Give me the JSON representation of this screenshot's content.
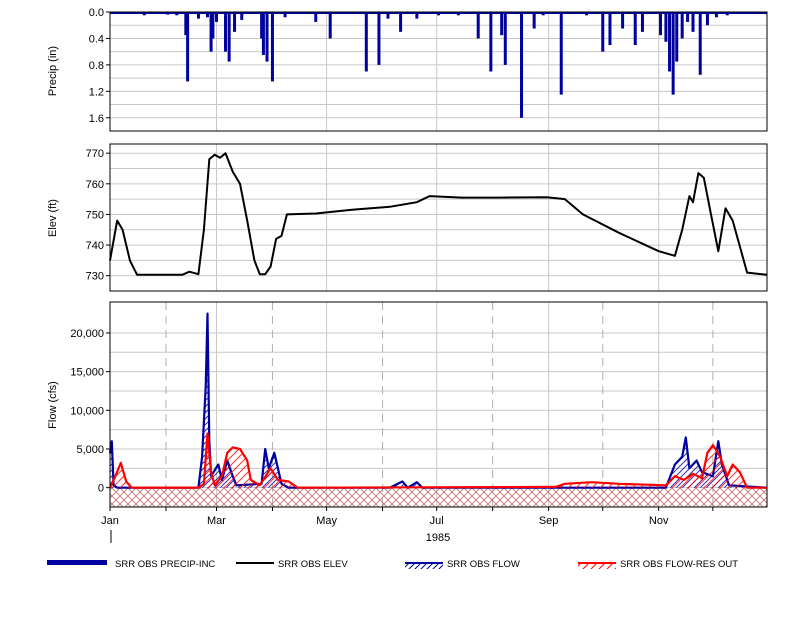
{
  "chart_data": {
    "type": "line",
    "x_axis": {
      "tick_labels": [
        "Jan",
        "Mar",
        "May",
        "Jul",
        "Sep",
        "Nov"
      ],
      "year_label": "1985",
      "range": [
        "1985-01-01",
        "1985-12-31"
      ]
    },
    "panels": {
      "precip": {
        "type": "bar",
        "ylabel": "Precip (in)",
        "ylim": [
          1.8,
          0.0
        ],
        "inverted": true,
        "ticks": [
          "0.0",
          "0.4",
          "0.8",
          "1.2",
          "1.6"
        ],
        "series_name": "SRR OBS PRECIP-INC",
        "color": "#0000a0",
        "events": [
          {
            "date": "1985-01-03",
            "value": 0.02
          },
          {
            "date": "1985-01-09",
            "value": 0.03
          },
          {
            "date": "1985-01-20",
            "value": 0.05
          },
          {
            "date": "1985-01-23",
            "value": 0.03
          },
          {
            "date": "1985-02-02",
            "value": 0.04
          },
          {
            "date": "1985-02-07",
            "value": 0.05
          },
          {
            "date": "1985-02-12",
            "value": 0.35
          },
          {
            "date": "1985-02-13",
            "value": 1.05
          },
          {
            "date": "1985-02-19",
            "value": 0.1
          },
          {
            "date": "1985-02-24",
            "value": 0.08
          },
          {
            "date": "1985-02-26",
            "value": 0.6
          },
          {
            "date": "1985-02-27",
            "value": 0.4
          },
          {
            "date": "1985-03-01",
            "value": 0.15
          },
          {
            "date": "1985-03-06",
            "value": 0.6
          },
          {
            "date": "1985-03-08",
            "value": 0.75
          },
          {
            "date": "1985-03-11",
            "value": 0.3
          },
          {
            "date": "1985-03-15",
            "value": 0.12
          },
          {
            "date": "1985-03-26",
            "value": 0.4
          },
          {
            "date": "1985-03-27",
            "value": 0.65
          },
          {
            "date": "1985-03-29",
            "value": 0.75
          },
          {
            "date": "1985-04-01",
            "value": 1.05
          },
          {
            "date": "1985-04-08",
            "value": 0.08
          },
          {
            "date": "1985-04-25",
            "value": 0.15
          },
          {
            "date": "1985-05-03",
            "value": 0.4
          },
          {
            "date": "1985-05-23",
            "value": 0.9
          },
          {
            "date": "1985-05-30",
            "value": 0.8
          },
          {
            "date": "1985-06-04",
            "value": 0.1
          },
          {
            "date": "1985-06-11",
            "value": 0.3
          },
          {
            "date": "1985-06-20",
            "value": 0.1
          },
          {
            "date": "1985-07-02",
            "value": 0.05
          },
          {
            "date": "1985-07-13",
            "value": 0.05
          },
          {
            "date": "1985-07-24",
            "value": 0.4
          },
          {
            "date": "1985-07-31",
            "value": 0.9
          },
          {
            "date": "1985-08-06",
            "value": 0.35
          },
          {
            "date": "1985-08-08",
            "value": 0.8
          },
          {
            "date": "1985-08-17",
            "value": 1.6
          },
          {
            "date": "1985-08-24",
            "value": 0.25
          },
          {
            "date": "1985-08-29",
            "value": 0.05
          },
          {
            "date": "1985-09-08",
            "value": 1.25
          },
          {
            "date": "1985-09-22",
            "value": 0.05
          },
          {
            "date": "1985-10-01",
            "value": 0.6
          },
          {
            "date": "1985-10-05",
            "value": 0.5
          },
          {
            "date": "1985-10-12",
            "value": 0.25
          },
          {
            "date": "1985-10-19",
            "value": 0.5
          },
          {
            "date": "1985-10-23",
            "value": 0.3
          },
          {
            "date": "1985-11-02",
            "value": 0.35
          },
          {
            "date": "1985-11-05",
            "value": 0.45
          },
          {
            "date": "1985-11-07",
            "value": 0.9
          },
          {
            "date": "1985-11-09",
            "value": 1.25
          },
          {
            "date": "1985-11-11",
            "value": 0.75
          },
          {
            "date": "1985-11-14",
            "value": 0.4
          },
          {
            "date": "1985-11-17",
            "value": 0.15
          },
          {
            "date": "1985-11-20",
            "value": 0.3
          },
          {
            "date": "1985-11-24",
            "value": 0.95
          },
          {
            "date": "1985-11-28",
            "value": 0.2
          },
          {
            "date": "1985-12-03",
            "value": 0.08
          },
          {
            "date": "1985-12-09",
            "value": 0.05
          },
          {
            "date": "1985-12-15",
            "value": 0.03
          }
        ]
      },
      "elev": {
        "type": "line",
        "ylabel": "Elev (ft)",
        "ylim": [
          725,
          773
        ],
        "ticks": [
          "730",
          "740",
          "750",
          "760",
          "770"
        ],
        "series_name": "SRR OBS ELEV",
        "color": "#000000",
        "points": [
          {
            "date": "1985-01-01",
            "value": 735
          },
          {
            "date": "1985-01-05",
            "value": 748
          },
          {
            "date": "1985-01-08",
            "value": 745
          },
          {
            "date": "1985-01-12",
            "value": 735
          },
          {
            "date": "1985-01-16",
            "value": 730.3
          },
          {
            "date": "1985-02-10",
            "value": 730.3
          },
          {
            "date": "1985-02-14",
            "value": 731.3
          },
          {
            "date": "1985-02-19",
            "value": 730.5
          },
          {
            "date": "1985-02-22",
            "value": 745
          },
          {
            "date": "1985-02-25",
            "value": 768
          },
          {
            "date": "1985-02-28",
            "value": 769.5
          },
          {
            "date": "1985-03-03",
            "value": 768.5
          },
          {
            "date": "1985-03-06",
            "value": 770
          },
          {
            "date": "1985-03-10",
            "value": 764
          },
          {
            "date": "1985-03-14",
            "value": 760
          },
          {
            "date": "1985-03-18",
            "value": 748
          },
          {
            "date": "1985-03-22",
            "value": 735
          },
          {
            "date": "1985-03-25",
            "value": 730.5
          },
          {
            "date": "1985-03-28",
            "value": 730.5
          },
          {
            "date": "1985-03-31",
            "value": 733
          },
          {
            "date": "1985-04-03",
            "value": 742
          },
          {
            "date": "1985-04-06",
            "value": 743
          },
          {
            "date": "1985-04-09",
            "value": 750
          },
          {
            "date": "1985-04-25",
            "value": 750.3
          },
          {
            "date": "1985-05-15",
            "value": 751.5
          },
          {
            "date": "1985-06-05",
            "value": 752.5
          },
          {
            "date": "1985-06-20",
            "value": 754
          },
          {
            "date": "1985-06-27",
            "value": 756
          },
          {
            "date": "1985-07-15",
            "value": 755.5
          },
          {
            "date": "1985-08-05",
            "value": 755.5
          },
          {
            "date": "1985-08-31",
            "value": 755.6
          },
          {
            "date": "1985-09-10",
            "value": 755
          },
          {
            "date": "1985-09-20",
            "value": 750
          },
          {
            "date": "1985-10-10",
            "value": 744
          },
          {
            "date": "1985-11-01",
            "value": 738
          },
          {
            "date": "1985-11-10",
            "value": 736.5
          },
          {
            "date": "1985-11-14",
            "value": 745
          },
          {
            "date": "1985-11-18",
            "value": 756
          },
          {
            "date": "1985-11-20",
            "value": 754
          },
          {
            "date": "1985-11-23",
            "value": 763.5
          },
          {
            "date": "1985-11-26",
            "value": 762
          },
          {
            "date": "1985-11-30",
            "value": 750
          },
          {
            "date": "1985-12-04",
            "value": 738
          },
          {
            "date": "1985-12-08",
            "value": 752
          },
          {
            "date": "1985-12-12",
            "value": 748
          },
          {
            "date": "1985-12-20",
            "value": 731
          },
          {
            "date": "1985-12-31",
            "value": 730.3
          }
        ]
      },
      "flow": {
        "type": "area",
        "ylabel": "Flow (cfs)",
        "ylim": [
          -2500,
          24000
        ],
        "ticks": [
          "0",
          "5,000",
          "10,000",
          "15,000",
          "20,000"
        ],
        "series": [
          {
            "name": "SRR OBS FLOW",
            "color": "#0000a0",
            "points": [
              {
                "date": "1985-01-01",
                "value": 4500
              },
              {
                "date": "1985-01-02",
                "value": 6000
              },
              {
                "date": "1985-01-03",
                "value": 300
              },
              {
                "date": "1985-01-05",
                "value": 0
              },
              {
                "date": "1985-02-19",
                "value": 0
              },
              {
                "date": "1985-02-21",
                "value": 4000
              },
              {
                "date": "1985-02-23",
                "value": 13000
              },
              {
                "date": "1985-02-24",
                "value": 22500
              },
              {
                "date": "1985-02-25",
                "value": 6000
              },
              {
                "date": "1985-02-26",
                "value": 1500
              },
              {
                "date": "1985-03-02",
                "value": 3000
              },
              {
                "date": "1985-03-04",
                "value": 1000
              },
              {
                "date": "1985-03-07",
                "value": 3500
              },
              {
                "date": "1985-03-10",
                "value": 1500
              },
              {
                "date": "1985-03-12",
                "value": 300
              },
              {
                "date": "1985-03-26",
                "value": 500
              },
              {
                "date": "1985-03-28",
                "value": 5000
              },
              {
                "date": "1985-03-30",
                "value": 2500
              },
              {
                "date": "1985-04-02",
                "value": 4500
              },
              {
                "date": "1985-04-06",
                "value": 500
              },
              {
                "date": "1985-04-10",
                "value": 0
              },
              {
                "date": "1985-06-05",
                "value": 0
              },
              {
                "date": "1985-06-12",
                "value": 800
              },
              {
                "date": "1985-06-15",
                "value": 0
              },
              {
                "date": "1985-06-20",
                "value": 700
              },
              {
                "date": "1985-06-23",
                "value": 0
              },
              {
                "date": "1985-11-05",
                "value": 0
              },
              {
                "date": "1985-11-10",
                "value": 3000
              },
              {
                "date": "1985-11-14",
                "value": 4000
              },
              {
                "date": "1985-11-16",
                "value": 6500
              },
              {
                "date": "1985-11-18",
                "value": 2500
              },
              {
                "date": "1985-11-22",
                "value": 3500
              },
              {
                "date": "1985-11-25",
                "value": 2000
              },
              {
                "date": "1985-12-01",
                "value": 1500
              },
              {
                "date": "1985-12-04",
                "value": 6000
              },
              {
                "date": "1985-12-06",
                "value": 3000
              },
              {
                "date": "1985-12-10",
                "value": 300
              },
              {
                "date": "1985-12-31",
                "value": 0
              }
            ]
          },
          {
            "name": "SRR OBS FLOW-RES OUT",
            "color": "#ff0000",
            "points": [
              {
                "date": "1985-01-01",
                "value": 0
              },
              {
                "date": "1985-01-04",
                "value": 1500
              },
              {
                "date": "1985-01-07",
                "value": 3200
              },
              {
                "date": "1985-01-10",
                "value": 800
              },
              {
                "date": "1985-01-13",
                "value": 0
              },
              {
                "date": "1985-02-19",
                "value": 0
              },
              {
                "date": "1985-02-22",
                "value": 500
              },
              {
                "date": "1985-02-24",
                "value": 7000
              },
              {
                "date": "1985-02-26",
                "value": 2000
              },
              {
                "date": "1985-02-28",
                "value": 300
              },
              {
                "date": "1985-03-04",
                "value": 1500
              },
              {
                "date": "1985-03-07",
                "value": 4500
              },
              {
                "date": "1985-03-10",
                "value": 5200
              },
              {
                "date": "1985-03-14",
                "value": 5000
              },
              {
                "date": "1985-03-18",
                "value": 3500
              },
              {
                "date": "1985-03-20",
                "value": 1000
              },
              {
                "date": "1985-03-25",
                "value": 300
              },
              {
                "date": "1985-03-31",
                "value": 2500
              },
              {
                "date": "1985-04-04",
                "value": 1000
              },
              {
                "date": "1985-04-10",
                "value": 800
              },
              {
                "date": "1985-04-15",
                "value": 0
              },
              {
                "date": "1985-09-05",
                "value": 100
              },
              {
                "date": "1985-09-10",
                "value": 500
              },
              {
                "date": "1985-09-25",
                "value": 700
              },
              {
                "date": "1985-10-10",
                "value": 500
              },
              {
                "date": "1985-11-05",
                "value": 300
              },
              {
                "date": "1985-11-10",
                "value": 1500
              },
              {
                "date": "1985-11-15",
                "value": 1000
              },
              {
                "date": "1985-11-20",
                "value": 1800
              },
              {
                "date": "1985-11-25",
                "value": 1200
              },
              {
                "date": "1985-11-28",
                "value": 4500
              },
              {
                "date": "1985-12-01",
                "value": 5500
              },
              {
                "date": "1985-12-05",
                "value": 4000
              },
              {
                "date": "1985-12-09",
                "value": 1500
              },
              {
                "date": "1985-12-12",
                "value": 3000
              },
              {
                "date": "1985-12-16",
                "value": 2000
              },
              {
                "date": "1985-12-20",
                "value": 0
              },
              {
                "date": "1985-12-31",
                "value": 0
              }
            ]
          }
        ]
      }
    },
    "legend": [
      {
        "label": "SRR OBS PRECIP-INC",
        "style": "thick-bar",
        "color": "#0000a0"
      },
      {
        "label": "SRR OBS ELEV",
        "style": "line",
        "color": "#000000"
      },
      {
        "label": "SRR OBS FLOW",
        "style": "hatched-line",
        "color": "#0000a0"
      },
      {
        "label": "SRR OBS FLOW-RES OUT",
        "style": "hatched-line",
        "color": "#ff0000"
      }
    ],
    "grid": true,
    "legend_placement": "bottom"
  }
}
